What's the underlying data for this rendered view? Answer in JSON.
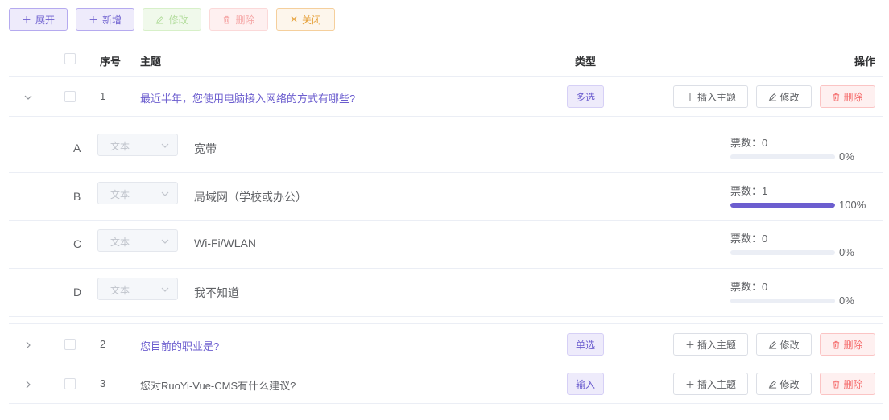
{
  "toolbar": {
    "expand": "展开",
    "add": "新增",
    "edit": "修改",
    "delete": "删除",
    "close": "关闭"
  },
  "header": {
    "index": "序号",
    "topic": "主题",
    "type": "类型",
    "actions": "操作"
  },
  "rows": [
    {
      "index": "1",
      "topic": "最近半年，您使用电脑接入网络的方式有哪些?",
      "type": "多选",
      "insert": "插入主题",
      "edit": "修改",
      "delete": "删除"
    },
    {
      "index": "2",
      "topic": "您目前的职业是?",
      "type": "单选",
      "insert": "插入主题",
      "edit": "修改",
      "delete": "删除"
    },
    {
      "index": "3",
      "topic": "您对RuoYi-Vue-CMS有什么建议?",
      "type": "输入",
      "insert": "插入主题",
      "edit": "修改",
      "delete": "删除"
    }
  ],
  "options": [
    {
      "letter": "A",
      "select": "文本",
      "text": "宽带",
      "votes": "票数：0",
      "percent": "0%",
      "ratio": 0
    },
    {
      "letter": "B",
      "select": "文本",
      "text": "局域网（学校或办公）",
      "votes": "票数：1",
      "percent": "100%",
      "ratio": 1
    },
    {
      "letter": "C",
      "select": "文本",
      "text": "Wi-Fi/WLAN",
      "votes": "票数：0",
      "percent": "0%",
      "ratio": 0
    },
    {
      "letter": "D",
      "select": "文本",
      "text": "我不知道",
      "votes": "票数：0",
      "percent": "0%",
      "ratio": 0
    }
  ],
  "colors": {
    "accent": "#6c5ecf",
    "danger": "#f56c6c",
    "warning": "#e6a23c"
  }
}
